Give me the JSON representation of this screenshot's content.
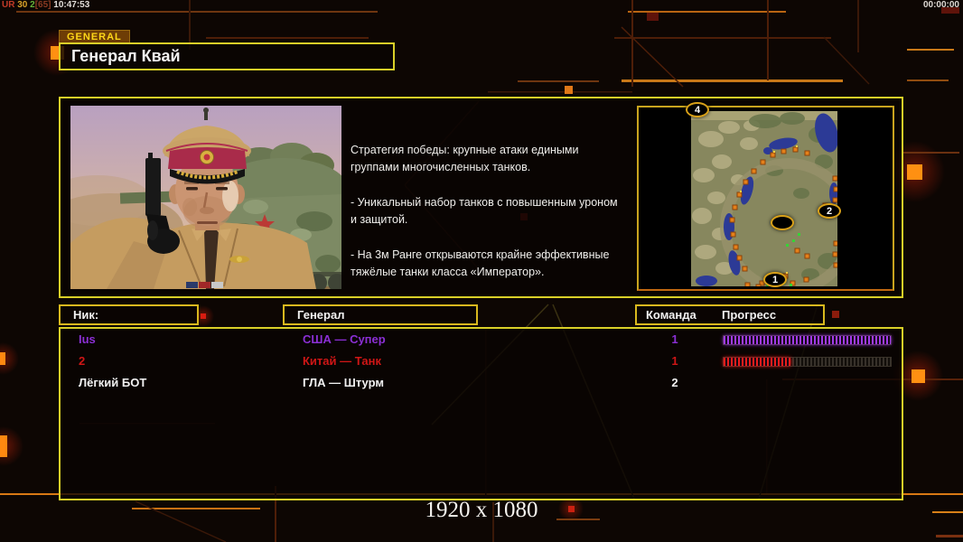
{
  "colors": {
    "panel_border": "#d9cf28",
    "header_border": "#d8b81e",
    "circuit_orange": "#b86412",
    "bright_square": "#ff9012"
  },
  "topbar": {
    "session_parts": [
      {
        "text": "UR",
        "color": "#c23a28"
      },
      {
        "text": " 30",
        "color": "#d8a028"
      },
      {
        "text": " 2",
        "color": "#66b33a"
      },
      {
        "text": "[65]",
        "color": "#8a3a22"
      },
      {
        "text": " 10:47:53",
        "color": "#e0dcd8"
      }
    ],
    "match_timer": "00:00:00"
  },
  "header": {
    "tab_label": "GENERAL",
    "title": "Генерал Квай"
  },
  "briefing": {
    "paragraphs": [
      "Стратегия победы: крупные атаки едиными\n группами многочисленных танков.",
      "- Уникальный набор танков с повышенным уроном\n и защитой.",
      "- На 3м Ранге открываются крайне эффективные\n тяжёлые танки класса «Император»."
    ]
  },
  "minimap": {
    "markers": [
      {
        "label": "4"
      },
      {
        "label": "2"
      },
      {
        "label": "1"
      },
      {
        "label": ""
      }
    ]
  },
  "roster": {
    "headers": {
      "nick": "Ник:",
      "general": "Генерал",
      "team": "Команда",
      "progress": "Прогресс"
    },
    "players": [
      {
        "name": "Ius",
        "general": "США — Супер",
        "team": "1",
        "color": "#8b2fd4",
        "bar_color": "#a13ae8",
        "progress_percent": 100,
        "progress_width": "100%"
      },
      {
        "name": "2",
        "general": "Китай — Танк",
        "team": "1",
        "color": "#cf1616",
        "bar_color": "#e81c1c",
        "progress_percent": 40,
        "progress_width": "40%"
      },
      {
        "name": "Лёгкий БОТ",
        "general": "ГЛА — Штурм",
        "team": "2",
        "color": "#f2f2f2"
      }
    ]
  },
  "footer": {
    "resolution": "1920 x 1080"
  }
}
